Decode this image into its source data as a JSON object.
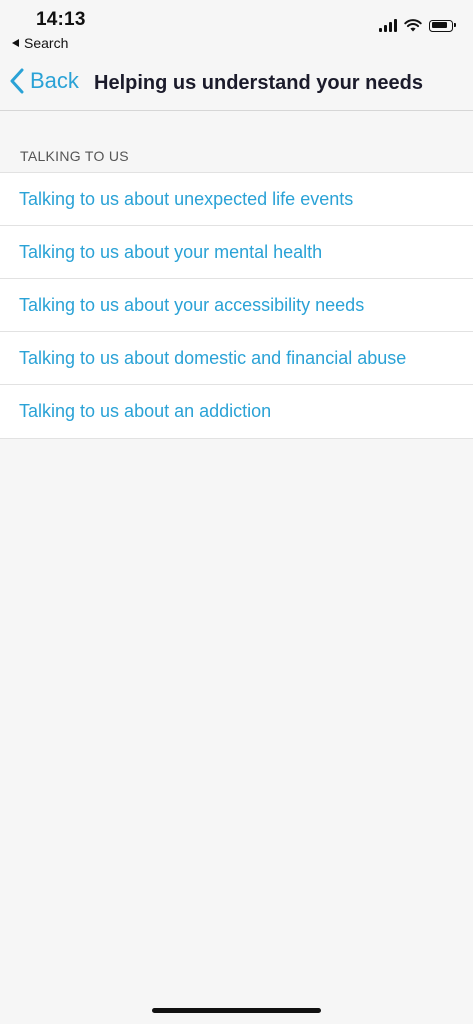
{
  "status_bar": {
    "time": "14:13",
    "back_app_label": "Search",
    "icons": [
      "signal-icon",
      "wifi-icon",
      "battery-icon"
    ]
  },
  "nav": {
    "back_label": "Back",
    "title": "Helping us understand your needs"
  },
  "section": {
    "header": "TALKING TO US",
    "items": [
      {
        "label": "Talking to us about unexpected life events"
      },
      {
        "label": "Talking to us about your mental health"
      },
      {
        "label": "Talking to us about your accessibility needs"
      },
      {
        "label": "Talking to us about domestic and financial abuse"
      },
      {
        "label": "Talking to us about an addiction"
      }
    ]
  },
  "colors": {
    "accent": "#2aa2d6",
    "background": "#f6f6f6",
    "list_background": "#ffffff",
    "title_text": "#1b1b2b"
  }
}
